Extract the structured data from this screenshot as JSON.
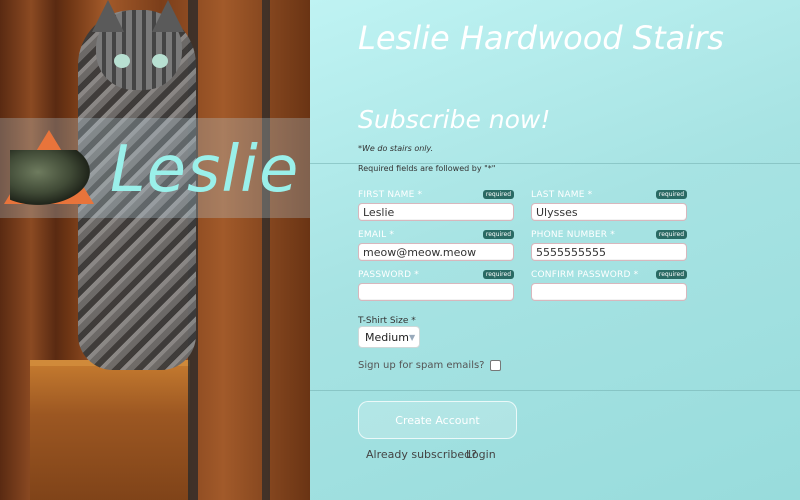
{
  "brand": {
    "logo_text": "Leslie"
  },
  "header": {
    "title": "Leslie Hardwood Stairs",
    "subtitle": "Subscribe now!",
    "note": "*We do stairs only.",
    "required_note": "Required fields are followed by \"*\""
  },
  "form": {
    "required_badge": "required",
    "first_name": {
      "label": "FIRST NAME *",
      "value": "Leslie"
    },
    "last_name": {
      "label": "LAST NAME *",
      "value": "Ulysses"
    },
    "email": {
      "label": "EMAIL *",
      "value": "meow@meow.meow"
    },
    "phone": {
      "label": "PHONE NUMBER *",
      "value": "5555555555"
    },
    "password": {
      "label": "PASSWORD *",
      "value": ""
    },
    "confirm_password": {
      "label": "CONFIRM PASSWORD *",
      "value": ""
    },
    "tshirt": {
      "label": "T-Shirt Size *",
      "selected": "Medium"
    },
    "spam": {
      "label": "Sign up for spam emails?"
    },
    "submit_label": "Create Account"
  },
  "footer": {
    "already_text": "Already subscribed?",
    "login_label": "Login"
  },
  "colors": {
    "panel": "#a7e3e3",
    "logo_text": "#9af0ea",
    "triangle": "#e8743b",
    "badge": "#2a6a64"
  }
}
